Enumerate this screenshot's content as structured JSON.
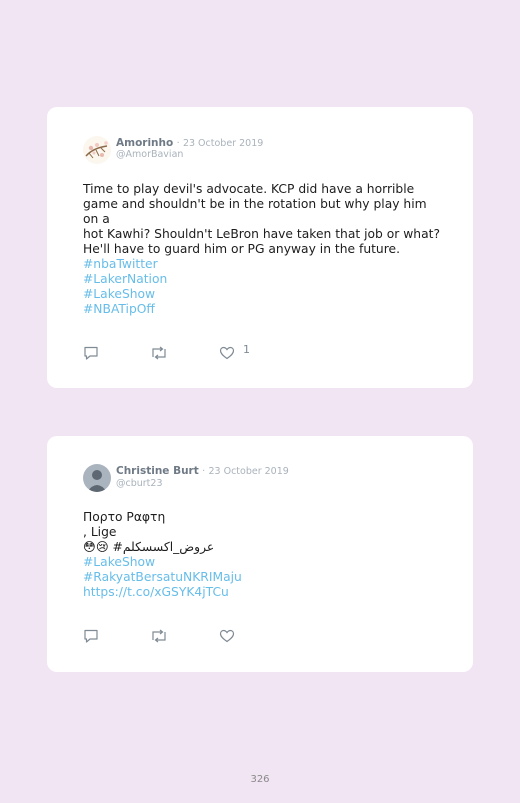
{
  "tweets": [
    {
      "name": "Amorinho",
      "date": "23 October 2019",
      "handle": "@AmorBavian",
      "text_lines": [
        "Time to play devil's advocate. KCP did have a horrible",
        "game and shouldn't be in the rotation but why play him on a",
        "hot Kawhi? Shouldn't LeBron have taken that job or what?",
        "He'll have to guard him or PG anyway in the future."
      ],
      "tags": [
        "#nbaTwitter",
        "#LakerNation",
        "#LakeShow",
        "#NBATipOff"
      ],
      "likes": "1"
    },
    {
      "name": "Christine Burt",
      "date": "23 October 2019",
      "handle": "@cburt23",
      "text_lines": [
        "Πορτο Ραφτη",
        ", Lige",
        "😳😢 #عروض_اكسسكلم"
      ],
      "tags": [
        "#LakeShow",
        "#RakyatBersatuNKRIMaju",
        "https://t.co/xGSYK4jTCu"
      ],
      "likes": ""
    }
  ],
  "separator": "·",
  "page_number": "326",
  "colors": {
    "background": "#f1e4f3",
    "link": "#67bde9",
    "icon": "#7f8a94"
  },
  "icons": [
    "reply-icon",
    "retweet-icon",
    "heart-icon"
  ]
}
